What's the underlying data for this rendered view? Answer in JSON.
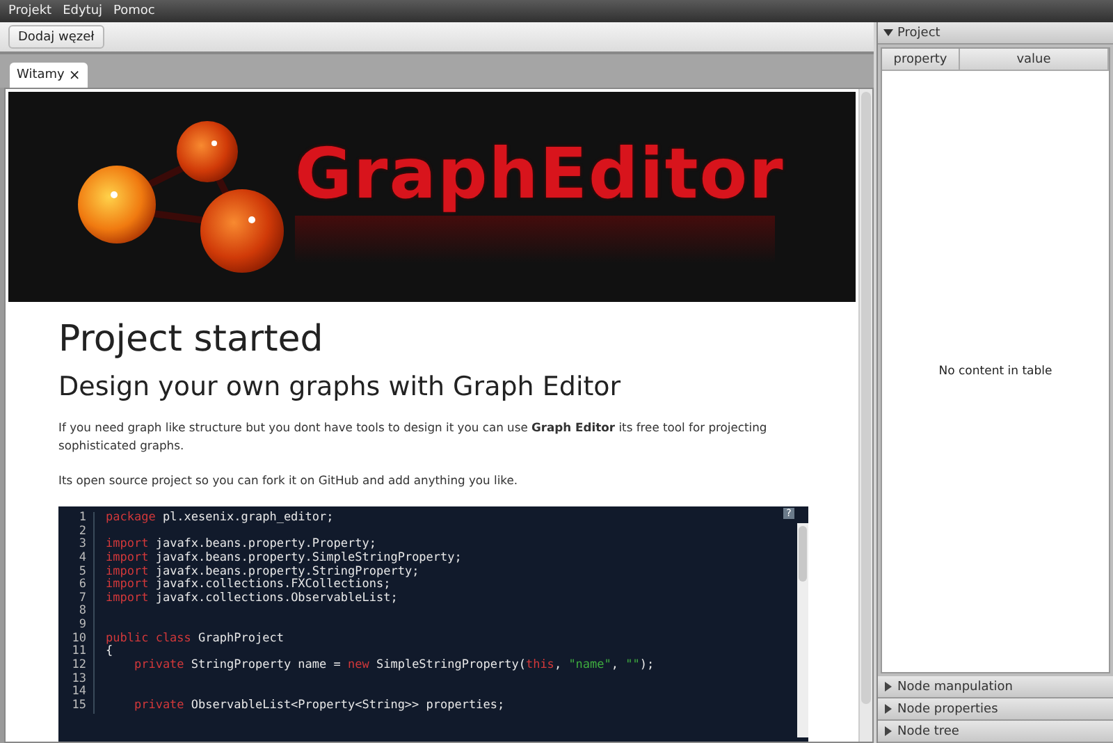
{
  "menu": [
    "Projekt",
    "Edytuj",
    "Pomoc"
  ],
  "toolbar": {
    "buttons": [
      "Dodaj węzeł"
    ]
  },
  "tabs": [
    {
      "label": "Witamy",
      "close": "×",
      "selected": true
    }
  ],
  "page": {
    "banner": {
      "logo_text": "GraphEditor"
    },
    "title": "Project started",
    "subtitle": "Design your own graphs with Graph Editor",
    "paragraphs": [
      "If you need graph like structure but you dont have tools to design it you can use **Graph Editor** its free tool for projecting sophisticated graphs.",
      "Its open source project so you can fork it on GitHub and add anything you like."
    ],
    "code": {
      "help": "?",
      "lines": [
        {
          "number": "1",
          "tokens": [
            {
              "kind": "keyword",
              "text": "package"
            },
            {
              "kind": "plain",
              "text": " pl.xesenix.graph_editor;"
            }
          ]
        },
        {
          "number": "2"
        },
        {
          "number": "3",
          "tokens": [
            {
              "kind": "keyword",
              "text": "import"
            },
            {
              "kind": "plain",
              "text": " javafx.beans.property.Property;"
            }
          ]
        },
        {
          "number": "4",
          "tokens": [
            {
              "kind": "keyword",
              "text": "import"
            },
            {
              "kind": "plain",
              "text": " javafx.beans.property.SimpleStringProperty;"
            }
          ]
        },
        {
          "number": "5",
          "tokens": [
            {
              "kind": "keyword",
              "text": "import"
            },
            {
              "kind": "plain",
              "text": " javafx.beans.property.StringProperty;"
            }
          ]
        },
        {
          "number": "6",
          "tokens": [
            {
              "kind": "keyword",
              "text": "import"
            },
            {
              "kind": "plain",
              "text": " javafx.collections.FXCollections;"
            }
          ]
        },
        {
          "number": "7",
          "tokens": [
            {
              "kind": "keyword",
              "text": "import"
            },
            {
              "kind": "plain",
              "text": " javafx.collections.ObservableList;"
            }
          ]
        },
        {
          "number": "8"
        },
        {
          "number": "9"
        },
        {
          "number": "10",
          "tokens": [
            {
              "kind": "keyword",
              "text": "public class"
            },
            {
              "kind": "plain",
              "text": " GraphProject"
            }
          ]
        },
        {
          "number": "11",
          "tokens": [
            {
              "kind": "plain",
              "text": "{"
            }
          ]
        },
        {
          "number": "12",
          "indent": true,
          "tokens": [
            {
              "kind": "keyword",
              "text": "private"
            },
            {
              "kind": "plain",
              "text": " StringProperty name = "
            },
            {
              "kind": "keyword",
              "text": "new"
            },
            {
              "kind": "plain",
              "text": " SimpleStringProperty("
            },
            {
              "kind": "keyword",
              "text": "this"
            },
            {
              "kind": "plain",
              "text": ", "
            },
            {
              "kind": "string",
              "text": "\"name\""
            },
            {
              "kind": "plain",
              "text": ", "
            },
            {
              "kind": "string",
              "text": "\"\""
            },
            {
              "kind": "plain",
              "text": ");"
            }
          ]
        },
        {
          "number": "13"
        },
        {
          "number": "14"
        },
        {
          "number": "15",
          "indent": true,
          "tokens": [
            {
              "kind": "keyword",
              "text": "private"
            },
            {
              "kind": "plain",
              "text": " ObservableList<Property<String>> properties;"
            }
          ]
        }
      ]
    }
  },
  "side_panels": [
    {
      "title": "Project",
      "expanded": true,
      "table": {
        "columns": [
          "property",
          "value"
        ],
        "placeholder": "No content in table"
      }
    },
    {
      "title": "Node manpulation",
      "expanded": false
    },
    {
      "title": "Node properties",
      "expanded": false
    },
    {
      "title": "Node tree",
      "expanded": false
    }
  ]
}
